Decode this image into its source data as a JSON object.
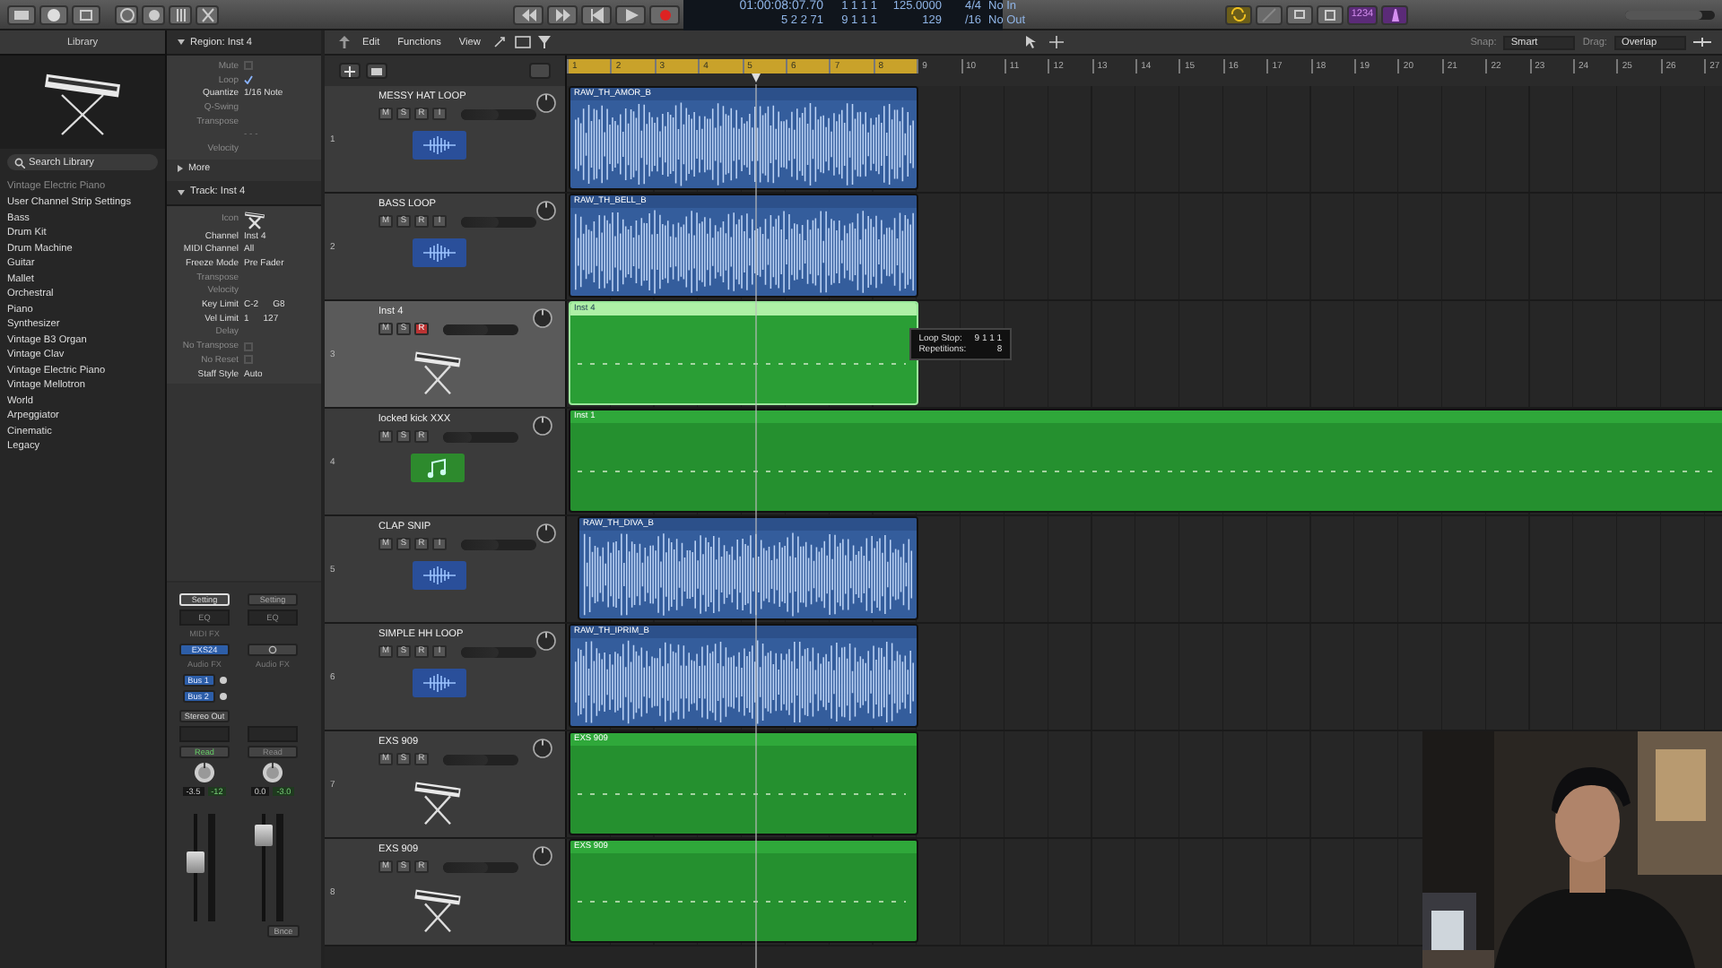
{
  "toolbar": {
    "cycle": {
      "on": true
    },
    "count_in": {
      "label": "1234",
      "on": true
    },
    "metronome": {
      "on": true
    },
    "master": {
      "level": 0.85
    },
    "lcd": {
      "row_1": [
        "01:00:08:07.70",
        "1 1 1 1",
        "125.0000",
        "4/4",
        "No In"
      ],
      "row_2": [
        "5 2 2 71",
        "9 1 1 1",
        "129",
        "/16",
        "No Out"
      ]
    }
  },
  "library": {
    "title": "Library",
    "search": {
      "placeholder": "Search Library"
    },
    "path": "Vintage Electric Piano",
    "items": [
      "User Channel Strip Settings",
      "Bass",
      "Drum Kit",
      "Drum Machine",
      "Guitar",
      "Mallet",
      "Orchestral",
      "Piano",
      "Synthesizer",
      "Vintage B3 Organ",
      "Vintage Clav",
      "Vintage Electric Piano",
      "Vintage Mellotron",
      "World",
      "Arpeggiator",
      "Cinematic",
      "Legacy"
    ]
  },
  "inspector": {
    "region": {
      "title": "Region: Inst 4",
      "expanded": true,
      "params": [
        {
          "label": "Mute",
          "kind": "check",
          "checked": false
        },
        {
          "label": "Loop",
          "kind": "check",
          "checked": true
        },
        {
          "label": "Quantize",
          "kind": "value",
          "value": "1/16 Note"
        },
        {
          "label": "Q-Swing",
          "kind": "value"
        },
        {
          "label": "Transpose",
          "kind": "value"
        },
        {
          "label": "- - -",
          "kind": "divider"
        },
        {
          "label": "Velocity",
          "kind": "value"
        }
      ]
    },
    "more": {
      "label": "More",
      "expanded": false
    },
    "track": {
      "title": "Track: Inst 4",
      "expanded": true,
      "params": [
        {
          "label": "Icon",
          "kind": "icon"
        },
        {
          "label": "Channel",
          "kind": "value",
          "value": "Inst 4"
        },
        {
          "label": "MIDI Channel",
          "kind": "value",
          "value": "All"
        },
        {
          "label": "Freeze Mode",
          "kind": "value",
          "value": "Pre Fader"
        },
        {
          "label": "Transpose",
          "kind": "value"
        },
        {
          "label": "Velocity",
          "kind": "value"
        },
        {
          "label": "Key Limit",
          "kind": "value",
          "value": "C-2",
          "value_2": "G8"
        },
        {
          "label": "Vel Limit",
          "kind": "value",
          "value": "1",
          "value_2": "127"
        },
        {
          "label": "Delay",
          "kind": "value"
        },
        {
          "label": "No Transpose",
          "kind": "check",
          "checked": false
        },
        {
          "label": "No Reset",
          "kind": "check",
          "checked": false
        },
        {
          "label": "Staff Style",
          "kind": "value",
          "value": "Auto"
        }
      ]
    }
  },
  "channel_strips": [
    {
      "setting": "Setting",
      "selected": true,
      "eq": "EQ",
      "midi_fx": "MIDI FX",
      "instrument": "EXS24",
      "audio_fx": "Audio FX",
      "sends": [
        "Bus 1",
        "Bus 2"
      ],
      "output": "Stereo Out",
      "automation": "Read",
      "volume": "-3.5",
      "peak": "-12",
      "fader": {
        "level": 0.55
      }
    },
    {
      "setting": "Setting",
      "selected": false,
      "eq": "EQ",
      "audio_fx": "Audio FX",
      "automation": "Read",
      "volume": "0.0",
      "peak": "-3.0",
      "fader": {
        "level": 0.8
      },
      "bounce": "Bnce"
    }
  ],
  "arrange": {
    "menus": [
      "Edit",
      "Functions",
      "View"
    ],
    "snap": {
      "label": "Snap:",
      "value": "Smart"
    },
    "drag": {
      "label": "Drag:",
      "value": "Overlap"
    },
    "ruler": [
      {
        "label": "1",
        "in_cycle": true
      },
      {
        "label": "2",
        "in_cycle": true
      },
      {
        "label": "3",
        "in_cycle": true
      },
      {
        "label": "4",
        "in_cycle": true
      },
      {
        "label": "5",
        "in_cycle": true
      },
      {
        "label": "6",
        "in_cycle": true
      },
      {
        "label": "7",
        "in_cycle": true
      },
      {
        "label": "8",
        "in_cycle": true
      },
      {
        "label": "9",
        "in_cycle": false
      },
      {
        "label": "10",
        "in_cycle": false
      },
      {
        "label": "11",
        "in_cycle": false
      },
      {
        "label": "12",
        "in_cycle": false
      },
      {
        "label": "13",
        "in_cycle": false
      },
      {
        "label": "14",
        "in_cycle": false
      },
      {
        "label": "15",
        "in_cycle": false
      },
      {
        "label": "16",
        "in_cycle": false
      },
      {
        "label": "17",
        "in_cycle": false
      },
      {
        "label": "18",
        "in_cycle": false
      },
      {
        "label": "19",
        "in_cycle": false
      },
      {
        "label": "20",
        "in_cycle": false
      },
      {
        "label": "21",
        "in_cycle": false
      },
      {
        "label": "22",
        "in_cycle": false
      },
      {
        "label": "23",
        "in_cycle": false
      },
      {
        "label": "24",
        "in_cycle": false
      },
      {
        "label": "25",
        "in_cycle": false
      },
      {
        "label": "26",
        "in_cycle": false
      },
      {
        "label": "27",
        "in_cycle": false
      }
    ],
    "playhead": {
      "level": 0.163
    },
    "tooltip": {
      "lines": [
        {
          "label": "Loop Stop:",
          "value": "9 1 1 1"
        },
        {
          "label": "Repetitions:",
          "value": "8"
        }
      ]
    },
    "tracks": [
      {
        "number": "1",
        "name": "MESSY HAT LOOP",
        "kind": "audio",
        "selected": false,
        "buttons": [
          {
            "label": "M",
            "on": false
          },
          {
            "label": "S",
            "on": false
          },
          {
            "label": "R",
            "on": false
          },
          {
            "label": "I",
            "on": false
          }
        ],
        "volume": {
          "level": 0.5
        },
        "region": {
          "name": "RAW_TH_AMOR_B",
          "kind": "audio",
          "selected": false,
          "starts_late": false,
          "extends_past_view": false
        }
      },
      {
        "number": "2",
        "name": "BASS LOOP",
        "kind": "audio",
        "selected": false,
        "buttons": [
          {
            "label": "M",
            "on": false
          },
          {
            "label": "S",
            "on": false
          },
          {
            "label": "R",
            "on": false
          },
          {
            "label": "I",
            "on": false
          }
        ],
        "volume": {
          "level": 0.5
        },
        "region": {
          "name": "RAW_TH_BELL_B",
          "kind": "audio",
          "selected": false,
          "starts_late": false,
          "extends_past_view": false
        }
      },
      {
        "number": "3",
        "name": "Inst 4",
        "kind": "instrument",
        "selected": true,
        "buttons": [
          {
            "label": "M",
            "on": false
          },
          {
            "label": "S",
            "on": false
          },
          {
            "label": "R",
            "on": true
          }
        ],
        "volume": {
          "level": 0.6
        },
        "region": {
          "name": "Inst 4",
          "kind": "midi",
          "selected": true,
          "starts_late": false,
          "extends_past_view": false
        }
      },
      {
        "number": "4",
        "name": "locked kick XXX",
        "kind": "drummer",
        "selected": false,
        "buttons": [
          {
            "label": "M",
            "on": false
          },
          {
            "label": "S",
            "on": false
          },
          {
            "label": "R",
            "on": false
          }
        ],
        "volume": {
          "level": 0.38
        },
        "region": {
          "name": "Inst 1",
          "kind": "midi",
          "selected": false,
          "starts_late": false,
          "extends_past_view": true
        }
      },
      {
        "number": "5",
        "name": "CLAP SNIP",
        "kind": "audio",
        "selected": false,
        "buttons": [
          {
            "label": "M",
            "on": false
          },
          {
            "label": "S",
            "on": false
          },
          {
            "label": "R",
            "on": false
          },
          {
            "label": "I",
            "on": false
          }
        ],
        "volume": {
          "level": 0.5
        },
        "region": {
          "name": "RAW_TH_DIVA_B",
          "kind": "audio",
          "selected": false,
          "starts_late": true,
          "extends_past_view": false
        }
      },
      {
        "number": "6",
        "name": "SIMPLE HH LOOP",
        "kind": "audio",
        "selected": false,
        "buttons": [
          {
            "label": "M",
            "on": false
          },
          {
            "label": "S",
            "on": false
          },
          {
            "label": "R",
            "on": false
          },
          {
            "label": "I",
            "on": false
          }
        ],
        "volume": {
          "level": 0.5
        },
        "region": {
          "name": "RAW_TH_IPRIM_B",
          "kind": "audio",
          "selected": false,
          "starts_late": false,
          "extends_past_view": false
        }
      },
      {
        "number": "7",
        "name": "EXS 909",
        "kind": "instrument",
        "selected": false,
        "buttons": [
          {
            "label": "M",
            "on": false
          },
          {
            "label": "S",
            "on": false
          },
          {
            "label": "R",
            "on": false
          }
        ],
        "volume": {
          "level": 0.6
        },
        "region": {
          "name": "EXS 909",
          "kind": "midi",
          "selected": false,
          "starts_late": false,
          "extends_past_view": false
        }
      },
      {
        "number": "8",
        "name": "EXS 909",
        "kind": "instrument",
        "selected": false,
        "buttons": [
          {
            "label": "M",
            "on": false
          },
          {
            "label": "S",
            "on": false
          },
          {
            "label": "R",
            "on": false
          }
        ],
        "volume": {
          "level": 0.6
        },
        "region": {
          "name": "EXS 909",
          "kind": "midi",
          "selected": false,
          "starts_late": false,
          "extends_past_view": false
        }
      }
    ]
  }
}
